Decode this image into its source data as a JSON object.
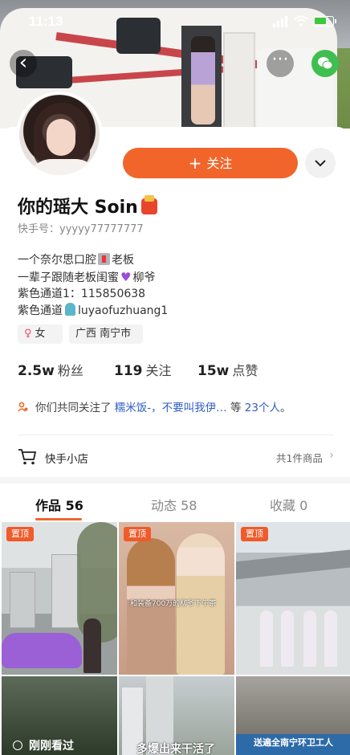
{
  "status": {
    "time": "11:13"
  },
  "profile": {
    "name": "你的瑶大 Soin",
    "kuaishou_id": "快手号：yyyyy77777777",
    "bio": [
      "一个奈尔思口腔",
      "老板",
      "一辈子跟随老板闺蜜",
      "柳爷",
      "紫色通道1：115850638",
      "紫色通道",
      "luyaofuzhuang1"
    ],
    "gender": "女",
    "location": "广西 南宁市"
  },
  "actions": {
    "follow_label": "关注"
  },
  "stats": {
    "fans_value": "2.5w",
    "fans_label": "粉丝",
    "following_value": "119",
    "following_label": "关注",
    "likes_value": "15w",
    "likes_label": "点赞"
  },
  "mutual": {
    "prefix": "你们共同关注了",
    "names": "糯米饭-，不要叫我伊…",
    "suffix_pre": "等",
    "count": "23个人",
    "suffix_post": "。"
  },
  "shop": {
    "label": "快手小店",
    "count": "共1件商品"
  },
  "tabs": [
    {
      "label": "作品 56"
    },
    {
      "label": "动态 58"
    },
    {
      "label": "收藏 0"
    }
  ],
  "grid": {
    "pinned_label": "置顶",
    "cell2_caption": "和装备700万的柳爷下午茶",
    "cell4_text": "刚刚看过",
    "cell5_text": "多爆出来干活了",
    "cell6_text": "送遍全南宁环卫工人"
  },
  "colors": {
    "accent": "#f1652b",
    "link": "#2f5ec4",
    "wechat": "#3fbf4f"
  },
  "icons": [
    "back-icon",
    "more-icon",
    "wechat-icon",
    "plus-icon",
    "chevron-down-icon",
    "cart-icon",
    "people-icon",
    "chevron-right-icon"
  ]
}
